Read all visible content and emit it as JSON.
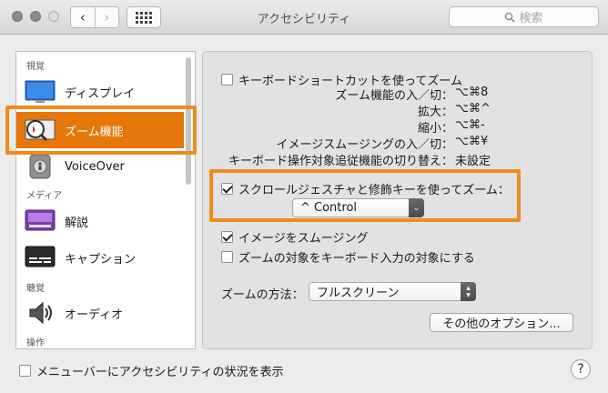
{
  "window": {
    "title": "アクセシビリティ",
    "back_glyph": "‹",
    "forward_glyph": "›",
    "search_placeholder": "検索"
  },
  "sidebar": {
    "headers": [
      "視覚",
      "メディア",
      "聴覚",
      "操作"
    ],
    "items": [
      {
        "label": "ディスプレイ",
        "icon": "display-icon"
      },
      {
        "label": "ズーム機能",
        "icon": "zoom-icon",
        "selected": true
      },
      {
        "label": "VoiceOver",
        "icon": "voiceover-icon"
      },
      {
        "label": "解説",
        "icon": "descriptions-icon"
      },
      {
        "label": "キャプション",
        "icon": "captions-icon"
      },
      {
        "label": "オーディオ",
        "icon": "audio-icon"
      }
    ]
  },
  "zoom": {
    "keyboard_shortcut_label": "キーボードショートカットを使ってズーム",
    "keyboard_shortcut_checked": false,
    "shortcuts": [
      {
        "label": "ズーム機能の入／切：",
        "key": "⌥⌘8"
      },
      {
        "label": "拡大：",
        "key": "⌥⌘^"
      },
      {
        "label": "縮小：",
        "key": "⌥⌘-"
      },
      {
        "label": "イメージスムージングの入／切：",
        "key": "⌥⌘¥"
      },
      {
        "label": "キーボード操作対象追従機能の切り替え：",
        "key": "未設定"
      }
    ],
    "scroll_gesture_label": "スクロールジェスチャと修飾キーを使ってズーム：",
    "scroll_gesture_checked": true,
    "modifier_value": "^ Control",
    "smoothing_label": "イメージをスムージング",
    "smoothing_checked": true,
    "follow_focus_label": "ズームの対象をキーボード入力の対象にする",
    "follow_focus_checked": false,
    "zoom_style_label": "ズームの方法：",
    "zoom_style_value": "フルスクリーン",
    "options_button": "その他のオプション..."
  },
  "footer": {
    "menubar_label": "メニューバーにアクセシビリティの状況を表示",
    "menubar_checked": false,
    "help_glyph": "?"
  },
  "colors": {
    "accent": "#e6770a",
    "annotation_outline": "#f08c1c"
  }
}
